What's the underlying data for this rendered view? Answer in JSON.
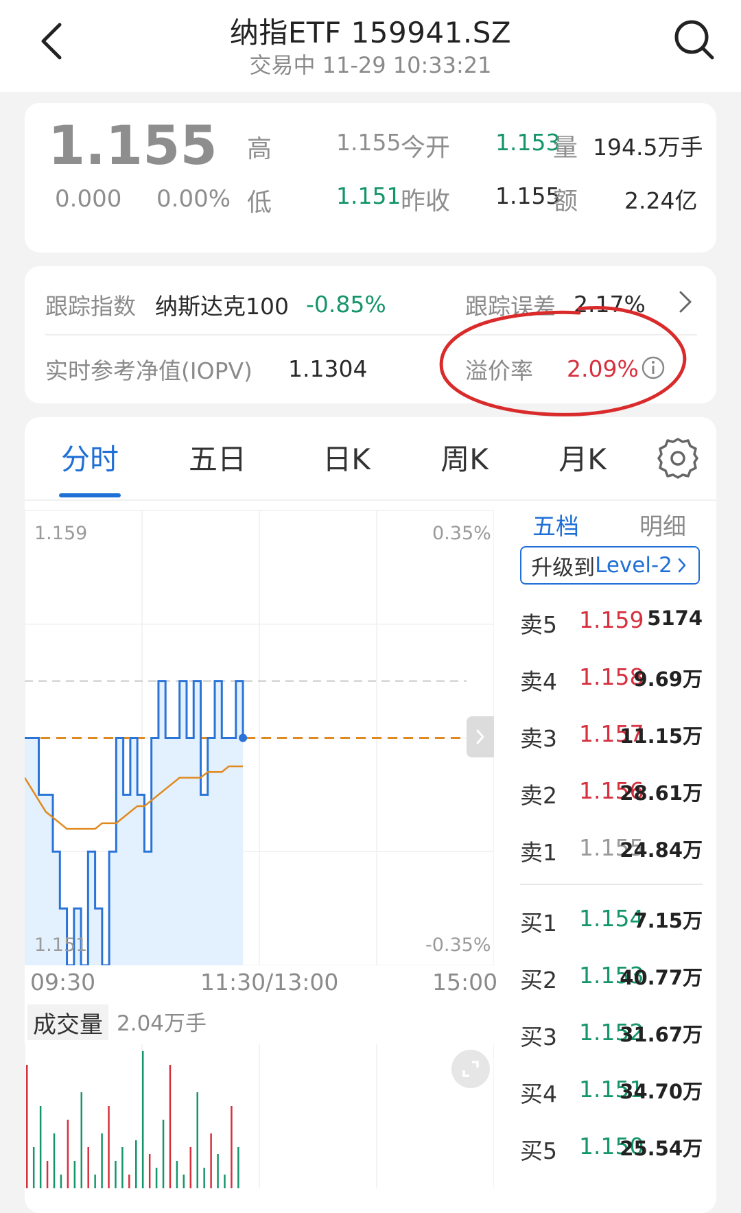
{
  "header": {
    "title": "纳指ETF 159941.SZ",
    "subtitle": "交易中 11-29 10:33:21"
  },
  "quote": {
    "price": "1.155",
    "change": "0.000",
    "change_pct": "0.00%",
    "high_label": "高",
    "high": "1.155",
    "low_label": "低",
    "low": "1.151",
    "open_label": "今开",
    "open": "1.153",
    "prev_close_label": "昨收",
    "prev_close": "1.155",
    "volume_label": "量",
    "volume": "194.5万手",
    "amount_label": "额",
    "amount": "2.24亿"
  },
  "tracking": {
    "index_label": "跟踪指数",
    "index_name": "纳斯达克100",
    "index_change": "-0.85%",
    "error_label": "跟踪误差",
    "error_value": "2.17%",
    "iopv_label": "实时参考净值(IOPV)",
    "iopv_value": "1.1304",
    "premium_label": "溢价率",
    "premium_value": "2.09%"
  },
  "tabs": [
    "分时",
    "五日",
    "日K",
    "周K",
    "月K"
  ],
  "chart_axis": {
    "top_price": "1.159",
    "bottom_price": "1.151",
    "top_pct": "0.35%",
    "bottom_pct": "-0.35%",
    "time_start": "09:30",
    "time_mid": "11:30/13:00",
    "time_end": "15:00"
  },
  "volume_section": {
    "label": "成交量",
    "value": "2.04万手"
  },
  "order_book": {
    "tab_five": "五档",
    "tab_detail": "明细",
    "upgrade_label": "升级到",
    "upgrade_level": "Level-2",
    "asks": [
      {
        "name": "卖5",
        "price": "1.159",
        "volume": "5174"
      },
      {
        "name": "卖4",
        "price": "1.158",
        "volume": "9.69万"
      },
      {
        "name": "卖3",
        "price": "1.157",
        "volume": "11.15万"
      },
      {
        "name": "卖2",
        "price": "1.156",
        "volume": "28.61万"
      },
      {
        "name": "卖1",
        "price": "1.155",
        "volume": "24.84万"
      }
    ],
    "bids": [
      {
        "name": "买1",
        "price": "1.154",
        "volume": "7.15万"
      },
      {
        "name": "买2",
        "price": "1.153",
        "volume": "40.77万"
      },
      {
        "name": "买3",
        "price": "1.152",
        "volume": "31.67万"
      },
      {
        "name": "买4",
        "price": "1.151",
        "volume": "34.70万"
      },
      {
        "name": "买5",
        "price": "1.150",
        "volume": "25.54万"
      }
    ]
  },
  "colors": {
    "up": "#d6303f",
    "down": "#15956a",
    "accent": "#1f6fd6",
    "avg_line": "#e08a1e",
    "annotation": "#d92b2b"
  },
  "chart_data": {
    "type": "line",
    "ylim": [
      1.151,
      1.159
    ],
    "series": [
      {
        "values": [
          1.155,
          1.155,
          1.154,
          1.154,
          1.153,
          1.152,
          1.151,
          1.152,
          1.151,
          1.153,
          1.152,
          1.151,
          1.153,
          1.155,
          1.154,
          1.155,
          1.154,
          1.153,
          1.155,
          1.156,
          1.155,
          1.155,
          1.156,
          1.155,
          1.156,
          1.154,
          1.155,
          1.156,
          1.155,
          1.155,
          1.156,
          1.155
        ]
      },
      {
        "values": [
          1.1543,
          1.1541,
          1.1539,
          1.1537,
          1.1536,
          1.1535,
          1.1534,
          1.1534,
          1.1534,
          1.1534,
          1.1534,
          1.1535,
          1.1535,
          1.1535,
          1.1536,
          1.1537,
          1.1538,
          1.1538,
          1.1539,
          1.154,
          1.1541,
          1.1542,
          1.1543,
          1.1543,
          1.1543,
          1.1543,
          1.1544,
          1.1544,
          1.1544,
          1.1545,
          1.1545,
          1.1545
        ]
      }
    ],
    "reference_line": 1.155,
    "volume_bars": [
      0.9,
      0.3,
      0.6,
      0.2,
      0.4,
      0.1,
      0.5,
      0.2,
      0.7,
      0.3,
      0.1,
      0.4,
      0.6,
      0.2,
      0.3,
      0.1,
      0.35,
      1.0,
      0.25,
      0.15,
      0.5,
      0.9,
      0.2,
      0.1,
      0.3,
      0.7,
      0.15,
      0.4,
      0.25,
      0.1,
      0.6,
      0.3
    ]
  }
}
